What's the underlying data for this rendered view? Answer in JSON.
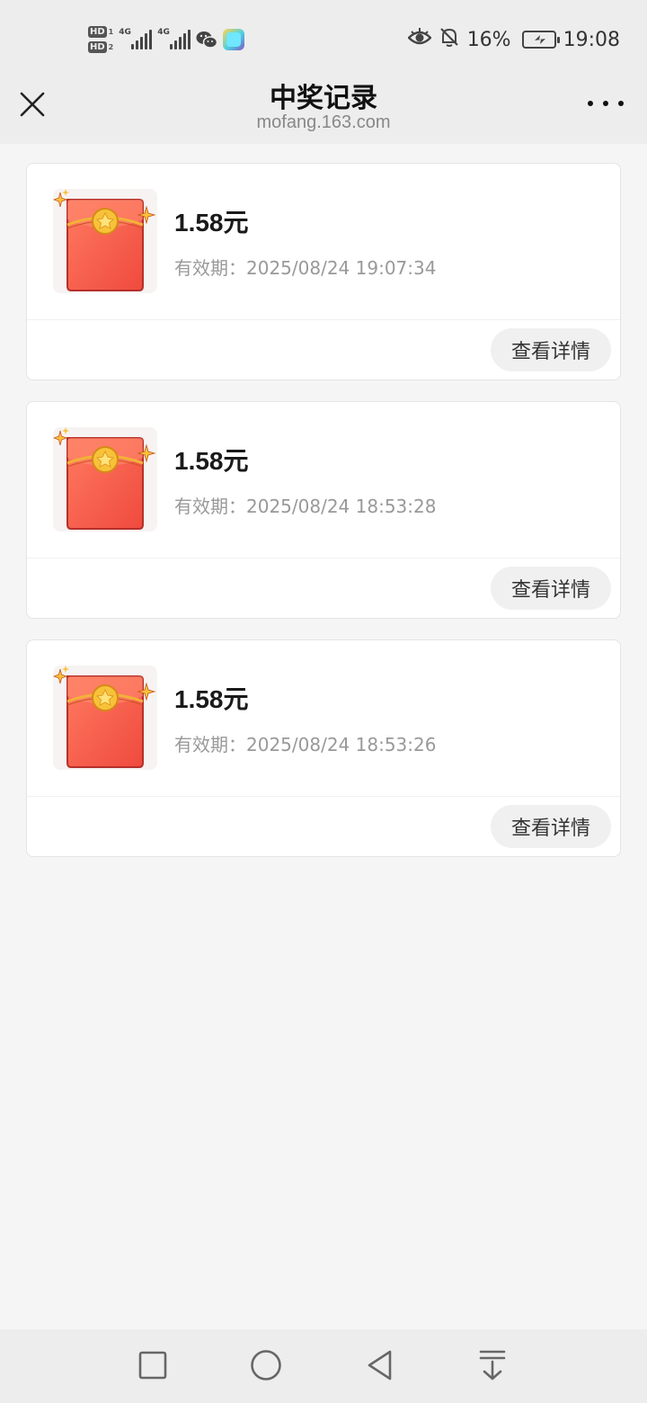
{
  "status_bar": {
    "hd1": "HD",
    "hd1_sim": "1",
    "hd2": "HD",
    "hd2_sim": "2",
    "net1": "4G",
    "net2": "4G",
    "battery_percent": "16%",
    "time": "19:08",
    "icons": [
      "hd-icon",
      "signal-icon",
      "wechat-icon",
      "app-icon",
      "eye-icon",
      "bell-off-icon",
      "battery-charging-icon"
    ]
  },
  "header": {
    "title": "中奖记录",
    "subtitle": "mofang.163.com",
    "close_icon": "close-icon",
    "more_icon": "more-icon"
  },
  "records": [
    {
      "amount": "1.58元",
      "validity": "有效期：2025/08/24 19:07:34",
      "button": "查看详情"
    },
    {
      "amount": "1.58元",
      "validity": "有效期：2025/08/24 18:53:28",
      "button": "查看详情"
    },
    {
      "amount": "1.58元",
      "validity": "有效期：2025/08/24 18:53:26",
      "button": "查看详情"
    }
  ],
  "nav": {
    "icons": [
      "recent-apps-icon",
      "home-icon",
      "back-icon",
      "notification-pull-icon"
    ]
  },
  "colors": {
    "page_bg": "#f5f5f5",
    "bar_bg": "#ededed",
    "card_bg": "#ffffff",
    "envelope_red": "#f0584a",
    "coin_gold": "#f7c23a",
    "button_bg": "#f0f0f0"
  }
}
